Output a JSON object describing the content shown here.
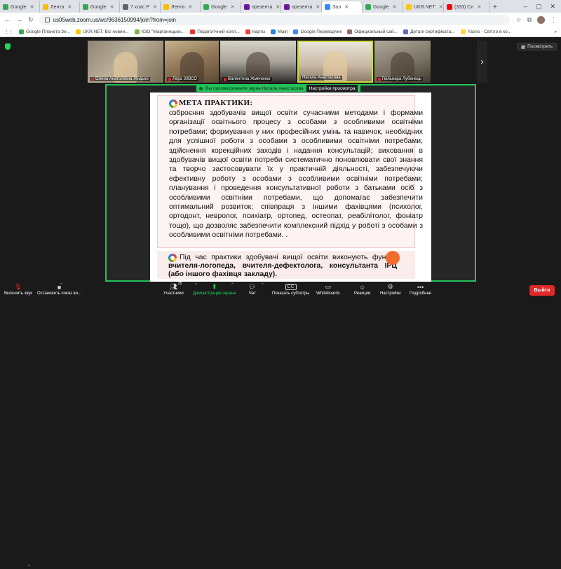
{
  "browser": {
    "tabs": [
      {
        "label": "Google",
        "color": "#34a853",
        "active": false
      },
      {
        "label": "Лента",
        "color": "#fbbc04",
        "active": false
      },
      {
        "label": "Google",
        "color": "#34a853",
        "active": false
      },
      {
        "label": "7 клас Р",
        "color": "#5f6368",
        "active": false
      },
      {
        "label": "Лента",
        "color": "#fbbc04",
        "active": false
      },
      {
        "label": "Google",
        "color": "#34a853",
        "active": false
      },
      {
        "label": "презента",
        "color": "#6a1b9a",
        "active": false
      },
      {
        "label": "презента",
        "color": "#6a1b9a",
        "active": false
      },
      {
        "label": "Зал",
        "color": "#2d8cff",
        "active": true
      },
      {
        "label": "Google",
        "color": "#34a853",
        "active": false
      },
      {
        "label": "UKR.NET",
        "color": "#f9c80e",
        "active": false
      },
      {
        "label": "(333) Сл",
        "color": "#ff0000",
        "active": false
      }
    ],
    "url": "us05web.zoom.us/wc/9636150994/join?from=join",
    "bookmarks": [
      {
        "label": "Google Планета Зе...",
        "color": "#34a853"
      },
      {
        "label": "UKR.NET: Всі новин...",
        "color": "#f9c80e"
      },
      {
        "label": "КЗО \"Марганецьки...",
        "color": "#7cb342"
      },
      {
        "label": "Педагогічний колл...",
        "color": "#e53935"
      },
      {
        "label": "Карты",
        "color": "#ea4335"
      },
      {
        "label": "Main",
        "color": "#1e88e5"
      },
      {
        "label": "Google Переводчик",
        "color": "#4285f4"
      },
      {
        "label": "Официальный сай...",
        "color": "#8d6e63"
      },
      {
        "label": "Деталі сертифіката...",
        "color": "#5c6bc0"
      },
      {
        "label": "Yasno - Світло в ко...",
        "color": "#fdd835"
      }
    ]
  },
  "meeting": {
    "view_button": "Посмотреть",
    "participants": [
      {
        "name": "Олена Анатоліївна Жидько"
      },
      {
        "name": "Лера 30ВСО"
      },
      {
        "name": "Валентина Жмеченко"
      },
      {
        "name": "Натала Анастасова"
      },
      {
        "name": "Гюльнара Лубенець"
      }
    ],
    "share_banner": "Вы просматриваете экран Натала Анастасова",
    "share_options": "Настройки просмотра"
  },
  "slide": {
    "title": "МЕТА ПРАКТИКИ:",
    "body": "озброєння здобувачів вищої освіти сучасними методами і формами організації освітнього процесу з особами з особливими освітніми потребами; формування у них професійних умінь та навичок, необхідних для успішної роботи з особами з особливими освітніми потребами; здійснення корекційних заходів і надання консультацій; виховання в здобувачів вищої освіти потреби систематично поновлювати свої знання та творчо застосовувати їх у практичній діяльності, забезпечуючи ефективну роботу з особами з особливими освітніми потребами; планування і проведення консультативної роботи з батьками осіб з особливими освітніми потребами, що допомагає забезпечити оптимальний розвиток; співпраця з іншими фахівцями (психолог, ортодонт, невролог, психіатр, ортопед, остеопат, реабілітолог, фоніатр тощо), що дозволяє забезпечити комплексний підхід у роботі з особами з особливими освітніми потребами. .",
    "footer_plain": "Під час практики здобувачі вищої освіти виконують функції ",
    "footer_bold": "вчителя-логопеда, вчителя-дефектолога, консультанта ІРЦ (або іншого фахівця закладу)."
  },
  "toolbar": {
    "unmute": "Включить звук",
    "stop_video": "Остановить показ ви...",
    "participants": "Участники",
    "participants_count": "25",
    "share": "Демонстрация экрана",
    "chat": "Чат",
    "captions": "Показать субтитры",
    "whiteboards": "Whiteboards",
    "reactions": "Реакции",
    "settings": "Настройки",
    "more": "Подробнее",
    "leave": "Выйти"
  }
}
